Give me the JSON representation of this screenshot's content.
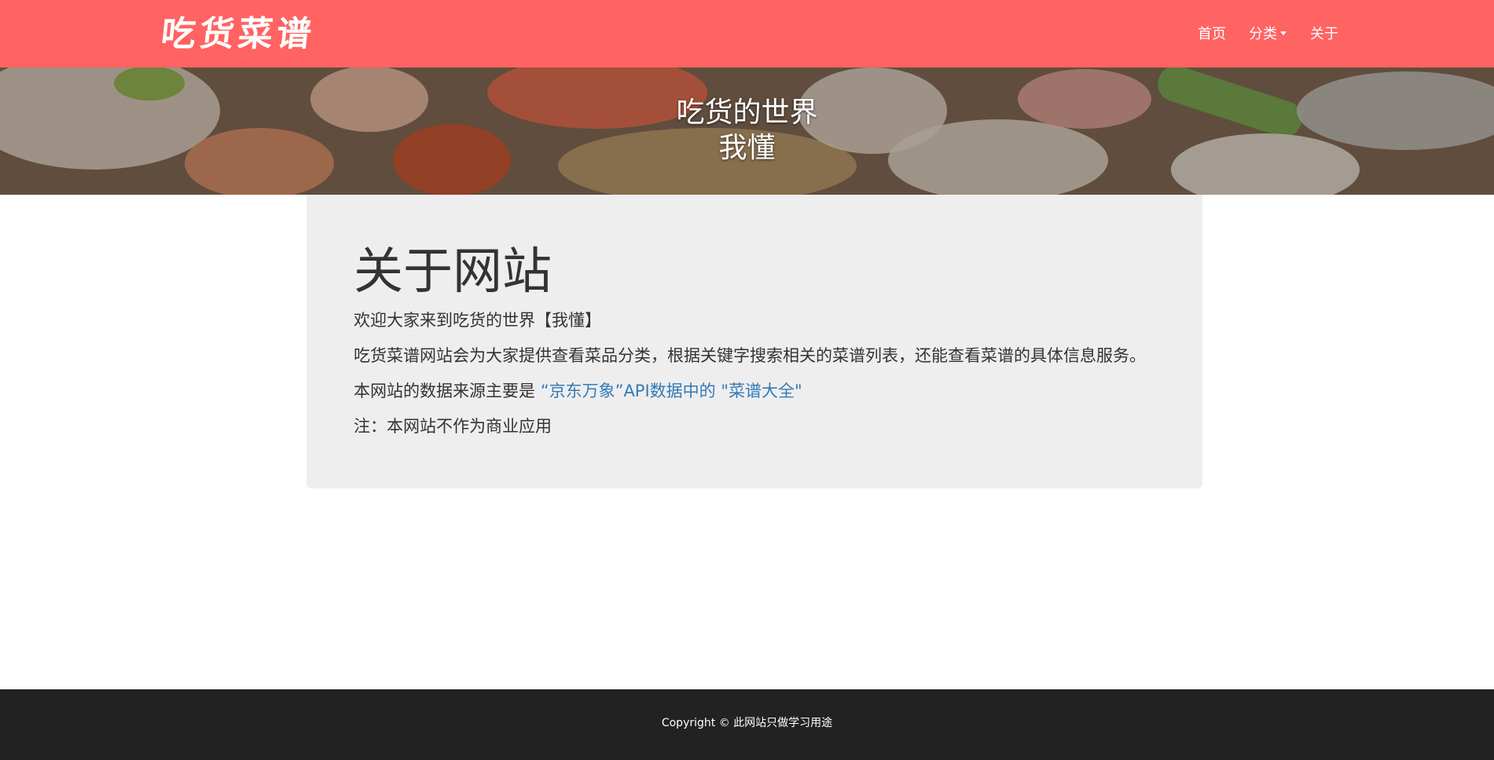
{
  "navbar": {
    "logo": "吃货菜谱",
    "items": [
      {
        "label": "首页"
      },
      {
        "label": "分类",
        "has_dropdown": true
      },
      {
        "label": "关于"
      }
    ],
    "caret_icon": "caret-down-icon",
    "background_color": "#ff6362"
  },
  "banner": {
    "title_line1": "吃货的世界",
    "title_line2": "我懂"
  },
  "about": {
    "heading": "关于网站",
    "line1": "欢迎大家来到吃货的世界【我懂】",
    "line2": "吃货菜谱网站会为大家提供查看菜品分类，根据关键字搜索相关的菜谱列表，还能查看菜谱的具体信息服务。",
    "line3_prefix": "本网站的数据来源主要是 ",
    "line3_link": "“京东万象”API数据中的 \"菜谱大全\"",
    "line4": "注：本网站不作为商业应用",
    "link_color": "#337ab7"
  },
  "footer": {
    "copyright": "Copyright © 此网站只做学习用途"
  }
}
